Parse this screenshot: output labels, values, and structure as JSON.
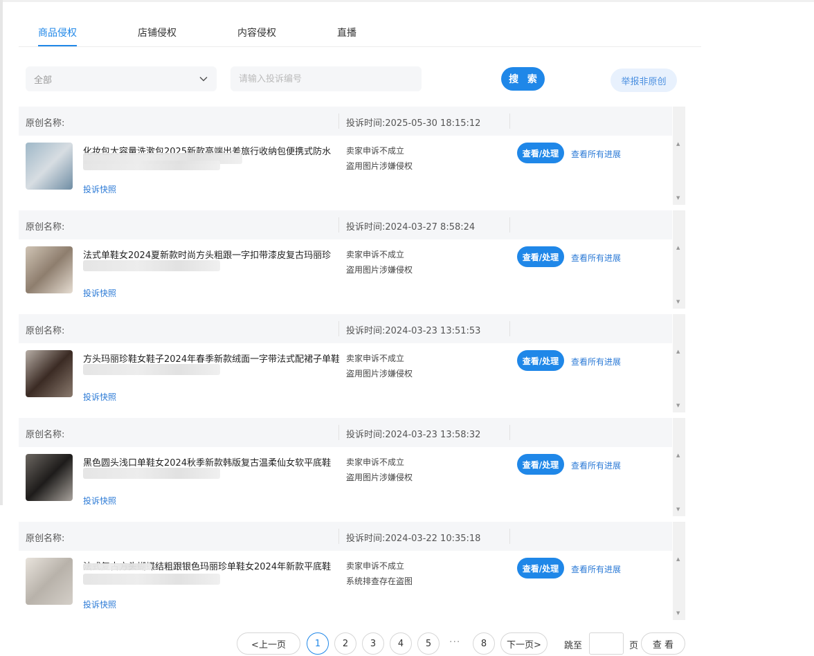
{
  "tabs": [
    {
      "label": "商品侵权",
      "active": true
    },
    {
      "label": "店铺侵权",
      "active": false
    },
    {
      "label": "内容侵权",
      "active": false
    },
    {
      "label": "直播",
      "active": false
    }
  ],
  "filter": {
    "select_value": "全部",
    "search_placeholder": "请输入投诉编号",
    "search_button": "搜 索",
    "report_button": "举报非原创"
  },
  "records": [
    {
      "orig_label": "原创名称:",
      "time": "投诉时间:2025-05-30 18:15:12",
      "title": "化妆包大容量洗漱包2025新款高端出差旅行收纳包便携式防水",
      "snapshot": "投诉快照",
      "status": "卖家申诉不成立",
      "reason": "盗用图片涉嫌侵权",
      "view_button": "查看/处理",
      "progress_link": "查看所有进展",
      "thumb_colors": [
        "#9fb8c8",
        "#d7dde2",
        "#6f8da4"
      ]
    },
    {
      "orig_label": "原创名称:",
      "time": "投诉时间:2024-03-27 8:58:24",
      "title": "法式单鞋女2024夏新款时尚方头粗跟一字扣带漆皮复古玛丽珍",
      "snapshot": "投诉快照",
      "status": "卖家申诉不成立",
      "reason": "盗用图片涉嫌侵权",
      "view_button": "查看/处理",
      "progress_link": "查看所有进展",
      "thumb_colors": [
        "#cfc3b4",
        "#8e7e6e",
        "#e6ddd2"
      ]
    },
    {
      "orig_label": "原创名称:",
      "time": "投诉时间:2024-03-23 13:51:53",
      "title": "方头玛丽珍鞋女鞋子2024年春季新款绒面一字带法式配裙子单鞋",
      "snapshot": "投诉快照",
      "status": "卖家申诉不成立",
      "reason": "盗用图片涉嫌侵权",
      "view_button": "查看/处理",
      "progress_link": "查看所有进展",
      "thumb_colors": [
        "#b7aea6",
        "#3b2b24",
        "#8a7a6e"
      ]
    },
    {
      "orig_label": "原创名称:",
      "time": "投诉时间:2024-03-23 13:58:32",
      "title": "黑色圆头浅口单鞋女2024秋季新款韩版复古温柔仙女软平底鞋",
      "snapshot": "投诉快照",
      "status": "卖家申诉不成立",
      "reason": "盗用图片涉嫌侵权",
      "view_button": "查看/处理",
      "progress_link": "查看所有进展",
      "thumb_colors": [
        "#6b6660",
        "#1e1c1b",
        "#a9a39d"
      ]
    },
    {
      "orig_label": "原创名称:",
      "time": "投诉时间:2024-03-22 10:35:18",
      "title": "法式复古方头蝴蝶结粗跟银色玛丽珍单鞋女2024年新款平底鞋",
      "snapshot": "投诉快照",
      "status": "卖家申诉不成立",
      "reason": "系统排查存在盗图",
      "view_button": "查看/处理",
      "progress_link": "查看所有进展",
      "thumb_colors": [
        "#e8e3dc",
        "#b8b2aa",
        "#d4cfc8"
      ]
    }
  ],
  "pagination": {
    "prev": "<上一页",
    "next": "下一页>",
    "pages": [
      "1",
      "2",
      "3",
      "4",
      "5"
    ],
    "ellipsis": "···",
    "last": "8",
    "current": 1,
    "jump_label": "跳至",
    "page_unit": "页",
    "go_button": "查 看"
  }
}
